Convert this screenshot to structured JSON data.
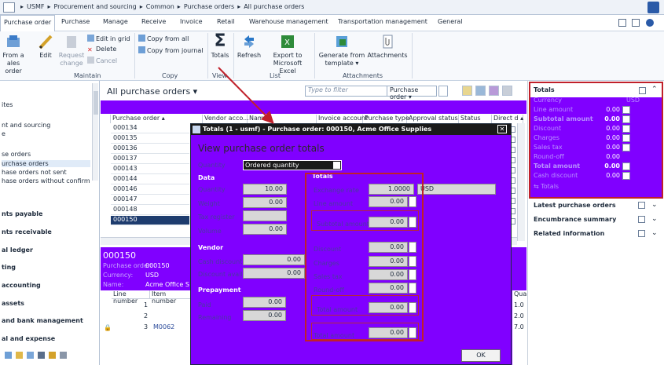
{
  "address": {
    "crumbs": [
      "USMF",
      "Procurement and sourcing",
      "Common",
      "Purchase orders",
      "All purchase orders"
    ]
  },
  "tabs": [
    "Purchase order",
    "Purchase",
    "Manage",
    "Receive",
    "Invoice",
    "Retail",
    "Warehouse management",
    "Transportation management",
    "General"
  ],
  "ribbon": {
    "from_a": "From a",
    "sales_order": "ales order",
    "edit": "Edit",
    "request_change": "Request",
    "request_change2": "change",
    "edit_in_grid": "Edit in grid",
    "delete": "Delete",
    "cancel": "Cancel",
    "copy_from_all": "Copy from all",
    "copy_from_journal": "Copy from journal",
    "totals": "Totals",
    "refresh": "Refresh",
    "export": "Export to",
    "export2": "Microsoft Excel",
    "generate": "Generate from",
    "generate2": "template",
    "attachments": "Attachments",
    "groups": {
      "maintain": "Maintain",
      "copy": "Copy",
      "view": "View",
      "list": "List",
      "attachments": "Attachments"
    }
  },
  "nav": {
    "items": [
      {
        "label": "ites",
        "bold": false
      },
      {
        "label": "nt and sourcing",
        "bold": false
      },
      {
        "label": "e",
        "bold": false
      },
      {
        "label": "se orders",
        "bold": false
      },
      {
        "label": "urchase orders",
        "bold": false
      },
      {
        "label": "hase orders not sent",
        "bold": false
      },
      {
        "label": "hase orders without confirmed del",
        "bold": false
      },
      {
        "label": "nts payable",
        "bold": true
      },
      {
        "label": "nts receivable",
        "bold": true
      },
      {
        "label": "al ledger",
        "bold": true
      },
      {
        "label": "ting",
        "bold": true
      },
      {
        "label": "accounting",
        "bold": true
      },
      {
        "label": "assets",
        "bold": true
      },
      {
        "label": "and bank management",
        "bold": true
      },
      {
        "label": "al and expense",
        "bold": true
      }
    ]
  },
  "list": {
    "title": "All purchase orders",
    "filter_placeholder": "Type to filter",
    "scope": "Purchase order",
    "columns": [
      "Purchase order",
      "Vendor acco...",
      "Name",
      "Invoice account",
      "Purchase type",
      "Approval status",
      "Status",
      "Direct d"
    ],
    "rows": [
      "000134",
      "000135",
      "000136",
      "000137",
      "000143",
      "000144",
      "000146",
      "000147",
      "000148",
      "000150"
    ],
    "selected_row": "000150"
  },
  "detail": {
    "po_number": "000150",
    "line1_label": "Purchase order:",
    "line1_value": "000150",
    "line2_label": "Currency:",
    "line2_value": "USD",
    "line3_label": "Name:",
    "line3_value": "Acme Office Sup"
  },
  "lines": {
    "col_line": "Line number",
    "col_item": "Item number",
    "col_qty": "Quantit",
    "rows": [
      {
        "line": "1",
        "item": "",
        "qty": "1.0"
      },
      {
        "line": "2",
        "item": "",
        "qty": "2.0"
      },
      {
        "line": "3",
        "item": "M0062",
        "qty": "7.0"
      }
    ]
  },
  "dialog": {
    "title": "Totals (1 - usmf) - Purchase order: 000150, Acme Office Supplies",
    "heading": "View purchase order totals",
    "quantity_label": "Quantity",
    "quantity_value": "Ordered quantity",
    "data_section": "Data",
    "totals_section": "Totals",
    "vendor_section": "Vendor",
    "prepayment_section": "Prepayment",
    "data_fields": [
      {
        "label": "Quantity",
        "value": "10.00"
      },
      {
        "label": "Weight",
        "value": "0.00"
      },
      {
        "label": "Tax register",
        "value": ""
      },
      {
        "label": "Volume",
        "value": "0.00"
      }
    ],
    "vendor_fields": [
      {
        "label": "Cash discount",
        "value": "0.00"
      },
      {
        "label": "Discount available",
        "value": "0.00"
      }
    ],
    "prepayment_fields": [
      {
        "label": "Paid",
        "value": "0.00"
      },
      {
        "label": "Remaining",
        "value": "0.00"
      }
    ],
    "totals_fields": [
      {
        "label": "Exchange rate",
        "value": "1.0000"
      },
      {
        "label": "Line amount",
        "value": "0.00"
      },
      {
        "label": "Subtotal amount",
        "value": "0.00"
      },
      {
        "label": "Discount",
        "value": "0.00"
      },
      {
        "label": "Charges",
        "value": "0.00"
      },
      {
        "label": "Sales tax",
        "value": "0.00"
      },
      {
        "label": "Round-off",
        "value": "0.00"
      },
      {
        "label": "Total amount",
        "value": "0.00"
      },
      {
        "label": "Total amount",
        "value": "0.00"
      }
    ],
    "currency": "USD",
    "ok": "OK"
  },
  "factbox": {
    "totals_title": "Totals",
    "totals_rows": [
      {
        "label": "Currency",
        "value": "USD"
      },
      {
        "label": "Line amount",
        "value": "0.00"
      },
      {
        "label": "Subtotal amount",
        "value": "0.00"
      },
      {
        "label": "Discount",
        "value": "0.00"
      },
      {
        "label": "Charges",
        "value": "0.00"
      },
      {
        "label": "Sales tax",
        "value": "0.00"
      },
      {
        "label": "Round-off",
        "value": "0.00"
      },
      {
        "label": "Total amount",
        "value": "0.00"
      },
      {
        "label": "Cash discount",
        "value": "0.00"
      }
    ],
    "more_link": "Totals",
    "sections": [
      "Latest purchase orders",
      "Encumbrance summary",
      "Related information"
    ]
  },
  "colors": {
    "purple": "#8000ff",
    "highlight_red": "#c0202a",
    "selected_row": "#1e3c6e"
  }
}
